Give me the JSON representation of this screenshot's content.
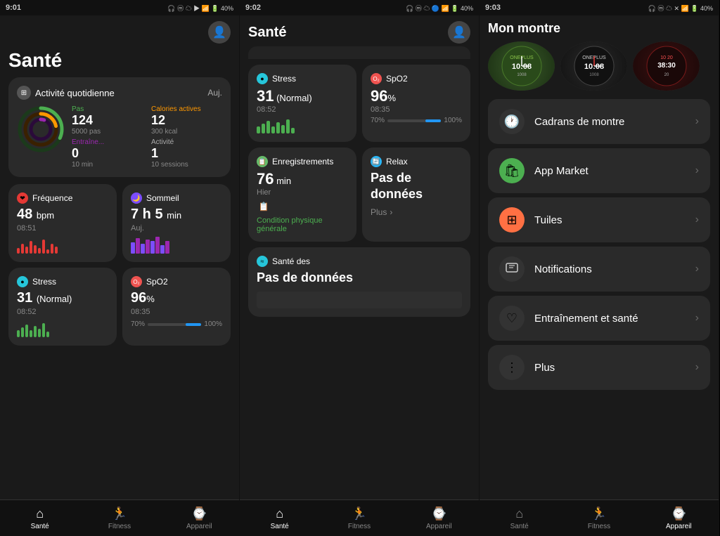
{
  "panels": [
    {
      "id": "panel1",
      "statusBar": {
        "time": "9:01",
        "icons": "🎧 ⓜ ☁ 🔋 40%"
      },
      "title": "Santé",
      "activityCard": {
        "label": "Activité quotidienne",
        "badge": "⊞",
        "today": "Auj.",
        "metrics": [
          {
            "label": "Pas",
            "color": "green",
            "value": "124",
            "sub": "5000 pas"
          },
          {
            "label": "Calories actives",
            "color": "orange",
            "value": "12",
            "sub": "300 kcal"
          },
          {
            "label": "Entraîne...",
            "color": "purple",
            "value": "0",
            "sub": "10 min"
          },
          {
            "label": "Activité",
            "color": "gray",
            "value": "1",
            "sub": "10 sessions"
          }
        ]
      },
      "healthCards": [
        {
          "id": "frequence",
          "icon": "❤️",
          "iconBg": "#e53935",
          "label": "Fréquence",
          "value": "48",
          "unit": " bpm",
          "time": "08:51",
          "chartType": "bars-red"
        },
        {
          "id": "sommeil",
          "icon": "🌙",
          "iconBg": "#7c4dff",
          "label": "Sommeil",
          "value": "7 h 5",
          "unit": " min",
          "time": "Auj.",
          "chartType": "bars-purple"
        },
        {
          "id": "stress1",
          "icon": "🔵",
          "iconBg": "#26c6da",
          "label": "Stress",
          "value": "31",
          "unit": " (Normal)",
          "time": "08:52",
          "chartType": "bars-green"
        },
        {
          "id": "spo2",
          "icon": "O₂",
          "iconBg": "#ef5350",
          "label": "SpO2",
          "value": "96",
          "unit": "%",
          "time": "08:35",
          "chartType": "progress"
        }
      ],
      "bottomNav": [
        {
          "icon": "🏠",
          "label": "Santé",
          "active": true
        },
        {
          "icon": "🏃",
          "label": "Fitness",
          "active": false
        },
        {
          "icon": "⌚",
          "label": "Appareil",
          "active": false
        }
      ]
    },
    {
      "id": "panel2",
      "statusBar": {
        "time": "9:02",
        "icons": "🎧 ⓜ ☁ 🔋 40%"
      },
      "title": "Santé",
      "cards": [
        {
          "id": "stress2",
          "icon": "🔵",
          "iconBg": "#26c6da",
          "label": "Stress",
          "value": "31",
          "valueUnit": " (Normal)",
          "time": "08:52",
          "chartType": "stress-bars",
          "wide": false
        },
        {
          "id": "spo2-2",
          "icon": "O₂",
          "iconBg": "#ef5350",
          "label": "SpO2",
          "value": "96",
          "valueUnit": "%",
          "time": "08:35",
          "chartType": "spo2-progress",
          "wide": false
        },
        {
          "id": "enregistrements",
          "icon": "📋",
          "iconBg": "#66bb6a",
          "label": "Enregistrements",
          "value": "76",
          "valueUnit": " min",
          "time": "Hier",
          "sub": "Condition physique générale",
          "subColor": "green",
          "chartType": "register",
          "wide": false
        },
        {
          "id": "relax",
          "icon": "🔄",
          "iconBg": "#29b6f6",
          "label": "Relax",
          "nodata": "Pas de données",
          "plus": "Plus",
          "wide": false
        },
        {
          "id": "sante-des",
          "icon": "≈",
          "iconBg": "#26c6da",
          "label": "Santé des",
          "nodata": "Pas de données",
          "wide": true
        }
      ],
      "bottomNav": [
        {
          "icon": "🏠",
          "label": "Santé",
          "active": true
        },
        {
          "icon": "🏃",
          "label": "Fitness",
          "active": false
        },
        {
          "icon": "⌚",
          "label": "Appareil",
          "active": false
        }
      ]
    },
    {
      "id": "panel3",
      "statusBar": {
        "time": "9:03",
        "icons": "🎧 ⓜ ☁ 🔋 40%"
      },
      "title": "Mon montre",
      "watchFaces": [
        {
          "id": "wf1",
          "style": "green"
        },
        {
          "id": "wf2",
          "style": "dark"
        },
        {
          "id": "wf3",
          "style": "red"
        }
      ],
      "menuItems": [
        {
          "id": "cadrans",
          "icon": "🕐",
          "iconBg": "#333",
          "label": "Cadrans de montre"
        },
        {
          "id": "appmarket",
          "icon": "🛍",
          "iconBg": "#4caf50",
          "label": "App Market"
        },
        {
          "id": "tuiles",
          "icon": "🟠",
          "iconBg": "#ff7043",
          "label": "Tuiles"
        },
        {
          "id": "notifications",
          "icon": "🔔",
          "iconBg": "#333",
          "label": "Notifications"
        },
        {
          "id": "entrainement",
          "icon": "♡",
          "iconBg": "#333",
          "label": "Entraînement et santé"
        },
        {
          "id": "plus",
          "icon": "⋮",
          "iconBg": "#333",
          "label": "Plus"
        }
      ],
      "bottomNav": [
        {
          "icon": "🏠",
          "label": "Santé",
          "active": false
        },
        {
          "icon": "🏃",
          "label": "Fitness",
          "active": false
        },
        {
          "icon": "⌚",
          "label": "Appareil",
          "active": true
        }
      ]
    }
  ]
}
